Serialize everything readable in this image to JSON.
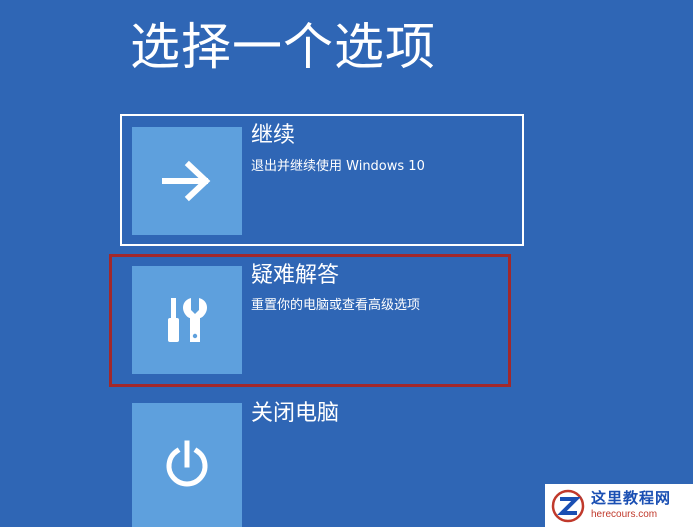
{
  "screen": {
    "title": "选择一个选项"
  },
  "options": [
    {
      "title": "继续",
      "description": "退出并继续使用 Windows 10",
      "icon": "arrow-right-icon"
    },
    {
      "title": "疑难解答",
      "description": "重置你的电脑或查看高级选项",
      "icon": "tools-icon"
    },
    {
      "title": "关闭电脑",
      "description": "",
      "icon": "power-icon"
    }
  ],
  "watermark": {
    "site_name": "这里教程网",
    "url": "herecours.com"
  },
  "colors": {
    "background": "#2f66b5",
    "tile": "#5ea0dd",
    "selected_border": "#ffffff",
    "highlight_border": "#a2282b"
  }
}
